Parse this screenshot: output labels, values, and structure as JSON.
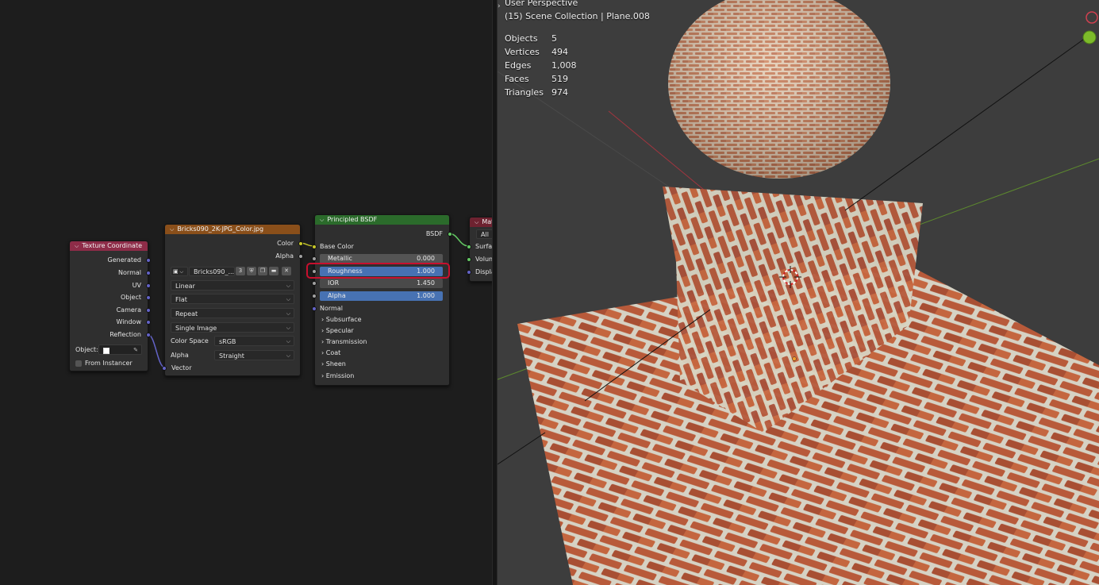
{
  "nodes": {
    "texcoord": {
      "title": "Texture Coordinate",
      "outputs": [
        "Generated",
        "Normal",
        "UV",
        "Object",
        "Camera",
        "Window",
        "Reflection"
      ],
      "object_label": "Object:",
      "from_instancer": "From Instancer"
    },
    "image": {
      "title": "Bricks090_2K-JPG_Color.jpg",
      "outputs": [
        "Color",
        "Alpha"
      ],
      "image_name": "Bricks090_...",
      "users": "3",
      "interpolation": "Linear",
      "projection": "Flat",
      "extension": "Repeat",
      "source": "Single Image",
      "color_space_label": "Color Space",
      "color_space": "sRGB",
      "alpha_label": "Alpha",
      "alpha_mode": "Straight",
      "vector_input": "Vector"
    },
    "bsdf": {
      "title": "Principled BSDF",
      "output": "BSDF",
      "base_color": "Base Color",
      "metallic_label": "Metallic",
      "metallic_value": "0.000",
      "roughness_label": "Roughness",
      "roughness_value": "1.000",
      "ior_label": "IOR",
      "ior_value": "1.450",
      "alpha_label": "Alpha",
      "alpha_value": "1.000",
      "normal": "Normal",
      "panels": [
        "Subsurface",
        "Specular",
        "Transmission",
        "Coat",
        "Sheen",
        "Emission"
      ]
    },
    "output": {
      "title": "Mat",
      "target": "All",
      "inputs": [
        "Surface",
        "Volume",
        "Displac"
      ]
    }
  },
  "viewport": {
    "perspective": "User Perspective",
    "collection": "(15) Scene Collection | Plane.008",
    "stats": [
      {
        "label": "Objects",
        "value": "5"
      },
      {
        "label": "Vertices",
        "value": "494"
      },
      {
        "label": "Edges",
        "value": "1,008"
      },
      {
        "label": "Faces",
        "value": "519"
      },
      {
        "label": "Triangles",
        "value": "974"
      }
    ]
  },
  "colors": {
    "texcoord_header": "#8e2c48",
    "image_header": "#8a4f1a",
    "bsdf_header": "#2b6b2b",
    "output_header": "#6e2230",
    "highlight": "#c8102e",
    "field_blue": "#4772b3"
  },
  "icons": [
    "chevron-down-icon",
    "image-icon",
    "shield-icon",
    "duplicate-icon",
    "folder-icon",
    "close-icon",
    "eyedropper-icon",
    "panel-chevron-icon",
    "object-icon"
  ]
}
